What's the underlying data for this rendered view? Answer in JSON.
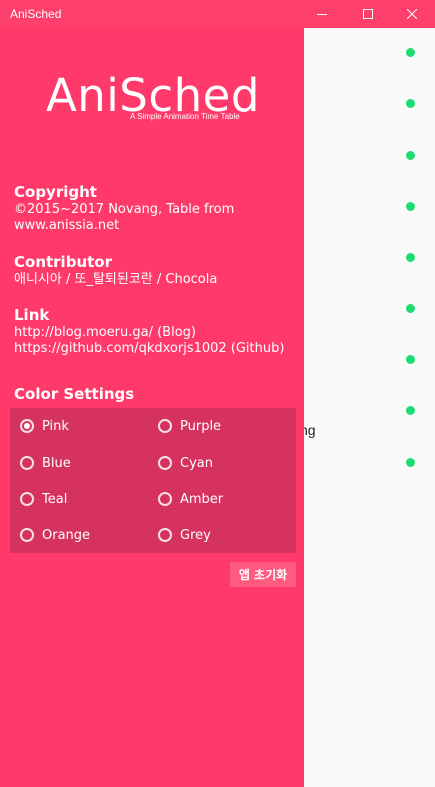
{
  "window": {
    "title": "AniSched"
  },
  "app": {
    "logo": "AniSched",
    "subtitle": "A Simple Animation Time Table"
  },
  "sections": {
    "copyright": {
      "title": "Copyright",
      "line1": "©2015~2017 Novang, Table from",
      "line2": "www.anissia.net"
    },
    "contributor": {
      "title": "Contributor",
      "line1": "애니시아 / 또_탈퇴된코란 / Chocola"
    },
    "link": {
      "title": "Link",
      "line1": "http://blog.moeru.ga/ (Blog)",
      "line2": "https://github.com/qkdxorjs1002 (Github)"
    }
  },
  "color_settings": {
    "title": "Color Settings",
    "selected": "Pink",
    "options": [
      {
        "label": "Pink",
        "checked": true
      },
      {
        "label": "Purple",
        "checked": false
      },
      {
        "label": "Blue",
        "checked": false
      },
      {
        "label": "Cyan",
        "checked": false
      },
      {
        "label": "Teal",
        "checked": false
      },
      {
        "label": "Amber",
        "checked": false
      },
      {
        "label": "Orange",
        "checked": false
      },
      {
        "label": "Grey",
        "checked": false
      }
    ]
  },
  "reset_button": {
    "label": "앱 초기화"
  },
  "background": {
    "partial_text": "ng"
  },
  "colors": {
    "accent": "#ff3a6b",
    "radio_box": "#d5325f",
    "status_dot": "#1ddc74"
  },
  "icons": {
    "minimize": "minimize-icon",
    "maximize": "maximize-icon",
    "close": "close-icon",
    "status": "status-dot-icon"
  }
}
